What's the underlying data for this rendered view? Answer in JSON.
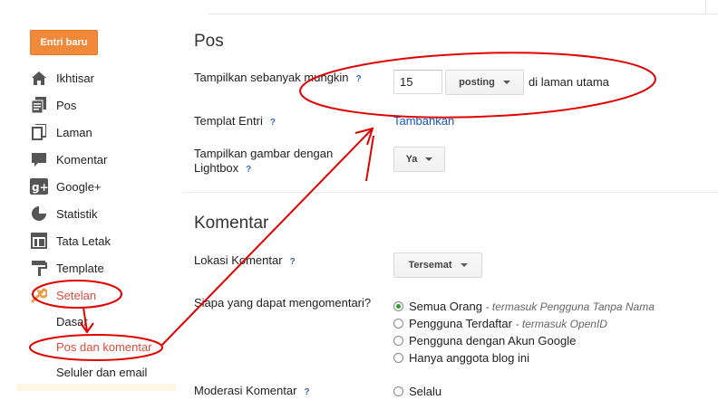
{
  "sidebar": {
    "new_post_label": "Entri baru",
    "items": [
      {
        "label": "Ikhtisar",
        "icon": "home-icon"
      },
      {
        "label": "Pos",
        "icon": "posts-icon"
      },
      {
        "label": "Laman",
        "icon": "pages-icon"
      },
      {
        "label": "Komentar",
        "icon": "comment-icon"
      },
      {
        "label": "Google+",
        "icon": "google-plus-icon"
      },
      {
        "label": "Statistik",
        "icon": "stats-icon"
      },
      {
        "label": "Tata Letak",
        "icon": "layout-icon"
      },
      {
        "label": "Template",
        "icon": "template-icon"
      },
      {
        "label": "Setelan",
        "icon": "wrench-icon"
      }
    ],
    "subitems": [
      "Dasar",
      "Pos dan komentar",
      "Seluler dan email"
    ]
  },
  "pos_section": {
    "title": "Pos",
    "show_at_most_label": "Tampilkan sebanyak mungkin",
    "show_at_most_value": "15",
    "unit_select": "posting",
    "suffix": "di laman utama",
    "template_label": "Templat Entri",
    "template_link": "Tambahkan",
    "lightbox_label": "Tampilkan gambar dengan Lightbox",
    "lightbox_value": "Ya",
    "help_glyph": "?"
  },
  "comment_section": {
    "title": "Komentar",
    "location_label": "Lokasi Komentar",
    "location_value": "Tersemat",
    "who_label": "Siapa yang dapat mengomentari?",
    "options": [
      {
        "label": "Semua Orang",
        "note": "- termasuk Pengguna Tanpa Nama",
        "checked": true
      },
      {
        "label": "Pengguna Terdaftar",
        "note": "- termasuk OpenID",
        "checked": false
      },
      {
        "label": "Pengguna dengan Akun Google",
        "note": "",
        "checked": false
      },
      {
        "label": "Hanya anggota blog ini",
        "note": "",
        "checked": false
      }
    ],
    "moderation_label": "Moderasi Komentar",
    "moderation_first_option": "Selalu"
  },
  "colors": {
    "accent": "#f0893a",
    "active": "#dd4b39",
    "link": "#1155cc",
    "annotation": "#e00000"
  }
}
